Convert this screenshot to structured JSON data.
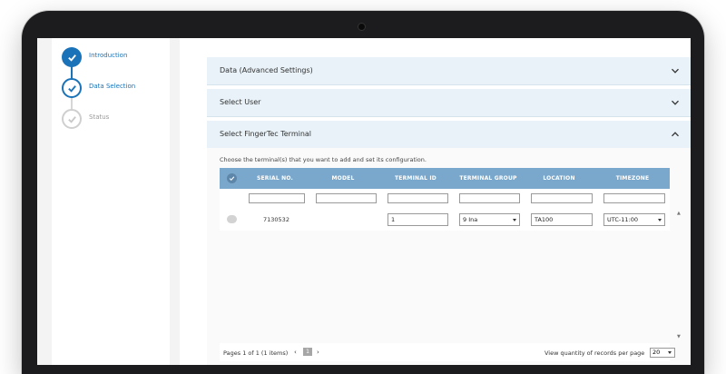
{
  "stepper": {
    "steps": [
      {
        "label": "Introduction",
        "state": "done"
      },
      {
        "label": "Data Selection",
        "state": "active"
      },
      {
        "label": "Status",
        "state": "pending"
      }
    ]
  },
  "panels": {
    "advanced": {
      "title": "Data (Advanced Settings)",
      "icon": "chevron-down-icon"
    },
    "user": {
      "title": "Select User",
      "icon": "chevron-down-icon"
    },
    "terminal": {
      "title": "Select FingerTec Terminal",
      "icon": "chevron-up-icon"
    }
  },
  "terminal_section": {
    "instruction": "Choose the terminal(s) that you want to add and set its configuration.",
    "columns": [
      "SERIAL NO.",
      "MODEL",
      "TERMINAL ID",
      "TERMINAL GROUP",
      "LOCATION",
      "TIMEZONE"
    ],
    "rows": [
      {
        "serial_no": "7130532",
        "model": "",
        "terminal_id": "1",
        "terminal_group": "9 Ina",
        "location": "TA100",
        "timezone": "UTC-11:00"
      }
    ]
  },
  "pager": {
    "info": "Pages 1 of 1 (1 items)",
    "prev": "‹",
    "current_page": "1",
    "next": "›",
    "quantity_label": "View quantity of records per page",
    "quantity_value": "20"
  },
  "colors": {
    "accent": "#1a73b8",
    "header_bg": "#7aa8cc",
    "panel_bg": "#e8f2f8"
  }
}
